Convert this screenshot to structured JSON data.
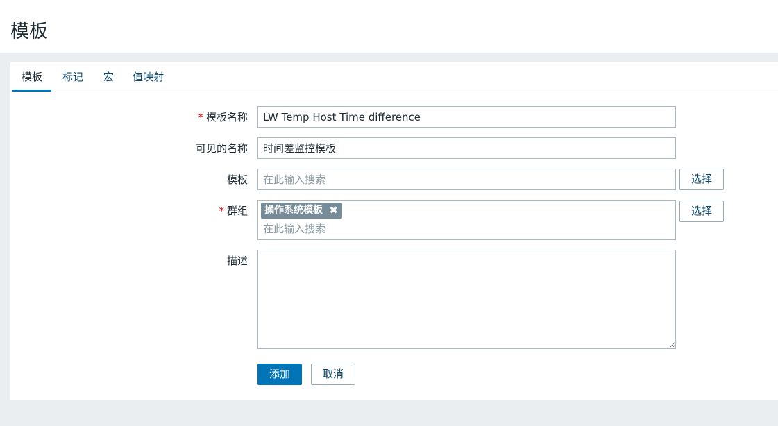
{
  "page": {
    "title": "模板"
  },
  "tabs": [
    {
      "label": "模板",
      "active": true
    },
    {
      "label": "标记",
      "active": false
    },
    {
      "label": "宏",
      "active": false
    },
    {
      "label": "值映射",
      "active": false
    }
  ],
  "form": {
    "template_name": {
      "required_mark": "*",
      "label": "模板名称",
      "value": "LW Temp Host Time difference"
    },
    "visible_name": {
      "label": "可见的名称",
      "value": "时间差监控模板"
    },
    "templates": {
      "label": "模板",
      "placeholder": "在此输入搜索",
      "select_label": "选择"
    },
    "groups": {
      "required_mark": "*",
      "label": "群组",
      "chips": [
        {
          "label": "操作系统模板",
          "remove_glyph": "✖"
        }
      ],
      "placeholder": "在此输入搜索",
      "select_label": "选择"
    },
    "description": {
      "label": "描述",
      "value": ""
    }
  },
  "actions": {
    "add_label": "添加",
    "cancel_label": "取消"
  },
  "colors": {
    "primary": "#0275b8",
    "required": "#d40000",
    "chip": "#768d99"
  }
}
